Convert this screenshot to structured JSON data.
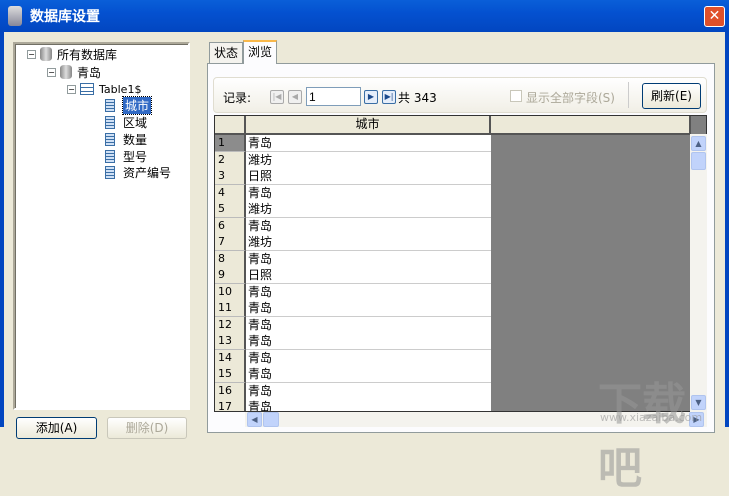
{
  "window": {
    "title": "数据库设置",
    "close": "✕"
  },
  "tree": {
    "root": "所有数据库",
    "db": "青岛",
    "table": "Table1$",
    "fields": [
      "城市",
      "区域",
      "数量",
      "型号",
      "资产编号"
    ]
  },
  "buttons": {
    "add": "添加(A)",
    "delete": "删除(D)"
  },
  "tabs": [
    "状态",
    "浏览"
  ],
  "toolbar": {
    "records_label": "记录:",
    "current": "1",
    "total": "共 343",
    "show_all": "显示全部字段(S)",
    "refresh": "刷新(E)"
  },
  "grid": {
    "column": "城市",
    "rows": [
      [
        "1",
        "青岛"
      ],
      [
        "2",
        "潍坊"
      ],
      [
        "3",
        "日照"
      ],
      [
        "4",
        "青岛"
      ],
      [
        "5",
        "潍坊"
      ],
      [
        "6",
        "青岛"
      ],
      [
        "7",
        "潍坊"
      ],
      [
        "8",
        "青岛"
      ],
      [
        "9",
        "日照"
      ],
      [
        "10",
        "青岛"
      ],
      [
        "11",
        "青岛"
      ],
      [
        "12",
        "青岛"
      ],
      [
        "13",
        "青岛"
      ],
      [
        "14",
        "青岛"
      ],
      [
        "15",
        "青岛"
      ],
      [
        "16",
        "青岛"
      ],
      [
        "17",
        "青岛"
      ]
    ]
  },
  "watermark": {
    "text": "下载吧",
    "url": "www.xiazaiba.com"
  }
}
